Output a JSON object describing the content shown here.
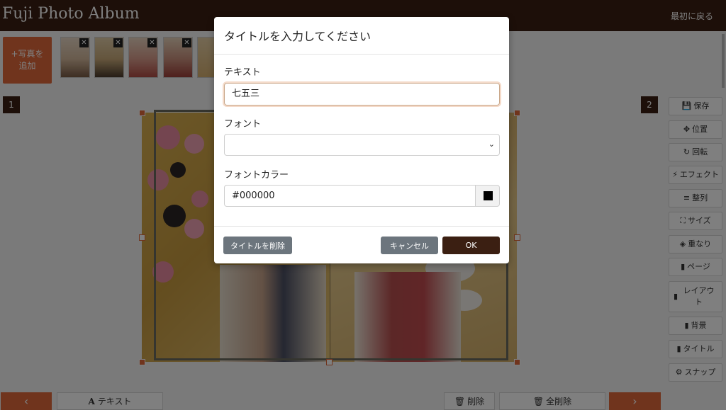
{
  "header": {
    "title": "Fuji Photo Album",
    "back_label": "最初に戻る"
  },
  "strip": {
    "add_photo": {
      "icon": "+",
      "line1": "写真を",
      "line2": "追加"
    },
    "remove_glyph": "✕"
  },
  "work": {
    "page_left": "1",
    "page_right": "2"
  },
  "toolbar": {
    "items": [
      {
        "icon": "💾",
        "label": "保存"
      },
      {
        "icon": "✥",
        "label": "位置"
      },
      {
        "icon": "↻",
        "label": "回転"
      },
      {
        "icon": "⚡",
        "label": "エフェクト"
      },
      {
        "icon": "≡",
        "label": "整列"
      },
      {
        "icon": "⛶",
        "label": "サイズ"
      },
      {
        "icon": "◈",
        "label": "重なり"
      },
      {
        "icon": "▮",
        "label": "ページ"
      },
      {
        "icon": "▮",
        "label": "レイアウト"
      },
      {
        "icon": "▮",
        "label": "背景"
      },
      {
        "icon": "▮",
        "label": "タイトル"
      },
      {
        "icon": "⚙",
        "label": "スナップ"
      }
    ]
  },
  "bottom": {
    "prev": "‹",
    "text_icon": "A",
    "text_label": "テキスト",
    "delete_icon": "🗑",
    "delete_label": "削除",
    "delete_all_icon": "🗑",
    "delete_all_label": "全削除",
    "next": "›"
  },
  "modal": {
    "title": "タイトルを入力してください",
    "text_label": "テキスト",
    "text_value": "七五三",
    "font_label": "フォント",
    "font_value": "",
    "color_label": "フォントカラー",
    "color_value": "#000000",
    "delete_title_button": "タイトルを削除",
    "cancel_button": "キャンセル",
    "ok_button": "OK"
  },
  "colors": {
    "brand_dark": "#3b1f12",
    "accent": "#e0693a",
    "secondary_button": "#6c757d",
    "font_color": "#000000"
  }
}
